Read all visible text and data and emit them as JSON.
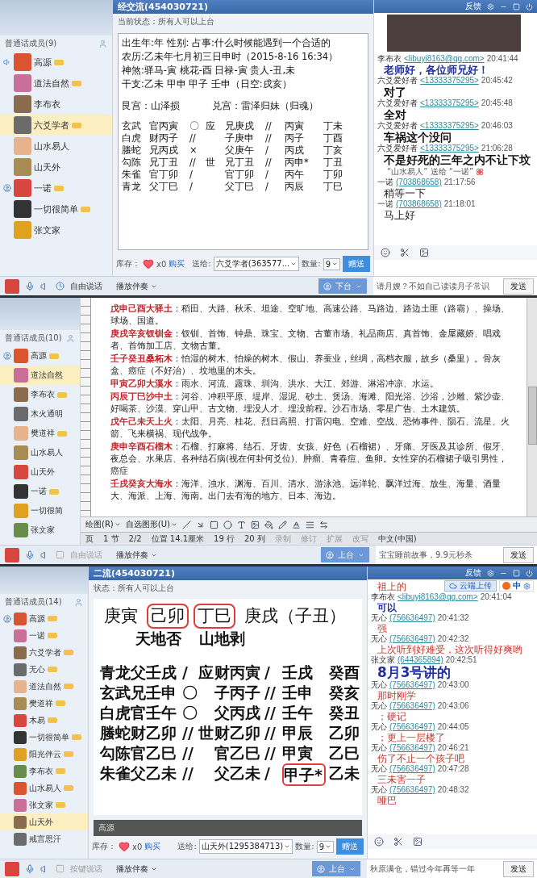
{
  "panels": [
    {
      "kind": "chart-room",
      "title": "经交流(454030721)",
      "status": "当前状态：所有人可以上台",
      "window_label": "反馈",
      "members_header": "普通话成员(9)",
      "members": [
        {
          "name": "高源",
          "vip": true,
          "selected": false,
          "kind": "speaking"
        },
        {
          "name": "道法自然",
          "vip": true,
          "selected": false,
          "kind": "member"
        },
        {
          "name": "李布衣",
          "vip": false,
          "selected": false,
          "kind": "member"
        },
        {
          "name": "六爻学者",
          "vip": true,
          "selected": true,
          "kind": "member"
        },
        {
          "name": "山水易人",
          "vip": false,
          "selected": false,
          "kind": "member"
        },
        {
          "name": "山天外",
          "vip": false,
          "selected": false,
          "kind": "member"
        },
        {
          "name": "一诺",
          "vip": true,
          "selected": false,
          "kind": "host"
        },
        {
          "name": "一切很简单",
          "vip": true,
          "selected": false,
          "kind": "member"
        },
        {
          "name": "张文家",
          "vip": false,
          "selected": false,
          "kind": "member"
        }
      ],
      "chart": {
        "lines": [
          "出生年:年  性别:  占事:什么时候能遇到一个合适的",
          "农历:乙未年七月初三日申时（2015-8-16 16:34）",
          "神煞:驿马-寅 桃花-酉 日禄-寅 贵人-丑,未",
          "干支:乙未  甲申  甲子  壬申（日空:戌亥）"
        ],
        "palaces": [
          "艮宫：山泽损",
          "兑宫：雷泽归妹（归魂）"
        ],
        "rows": [
          {
            "god": "玄武",
            "line_a": "官丙寅",
            "mark_a": "〇",
            "role": "应",
            "line_b": "兄庚戌",
            "mark_b": "//",
            "stem_a": "丙寅",
            "stem_b": "丁未"
          },
          {
            "god": "白虎",
            "line_a": "财丙子",
            "mark_a": "//",
            "line_b": "子庚申",
            "mark_b": "//",
            "stem_a": "丙子",
            "stem_b": "丁酉"
          },
          {
            "god": "螣蛇",
            "line_a": "兄丙戌",
            "mark_a": "×",
            "line_b": "父庚午",
            "mark_b": "/",
            "stem_a": "丙戌",
            "stem_b": "丁亥"
          },
          {
            "god": "勾陈",
            "line_a": "兄丁丑",
            "mark_a": "//",
            "role": "世",
            "line_b": "兄丁丑",
            "mark_b": "//",
            "stem_a": "丙申*",
            "stem_b": "丁丑"
          },
          {
            "god": "朱雀",
            "line_a": "官丁卯",
            "mark_a": "/",
            "line_b": "官丁卯",
            "mark_b": "/",
            "stem_a": "丙午",
            "stem_b": "丁卯"
          },
          {
            "god": "青龙",
            "line_a": "父丁巳",
            "mark_a": "/",
            "line_b": "父丁巳",
            "mark_b": "/",
            "stem_a": "丙辰",
            "stem_b": "丁巳"
          }
        ]
      },
      "gift": {
        "stock_label": "库存：",
        "count": "x0",
        "buy": "购买",
        "to_label": "送给:",
        "recipient": "六爻学者(363577...",
        "qty_label": "数量:",
        "qty": "9",
        "button": "赠送"
      },
      "video": true,
      "messages": [
        {
          "sender": "李布衣",
          "contact": "<libuyi8163@qq.com>",
          "time": "20:41:44",
          "text": "老师好，各位师兄好！",
          "kind": "bold-blue"
        },
        {
          "sender": "六爻爱好者",
          "contact": "<13333375295>",
          "time": "20:45:42",
          "text": "对了",
          "kind": "bold-black"
        },
        {
          "sender": "六爻爱好者",
          "contact": "<13333375295>",
          "time": "20:45:48",
          "text": "全对",
          "kind": "bold-black"
        },
        {
          "sender": "六爻爱好者",
          "contact": "<13333375295>",
          "time": "20:46:03",
          "text": "车祸这个没问",
          "kind": "bold-black"
        },
        {
          "sender": "六爻爱好者",
          "contact": "<13333375295>",
          "time": "21:06:28",
          "text": "不是好死的三年之内不让下坟",
          "kind": "bold-black"
        },
        {
          "text": "“山水易人” 送给 “一诺”",
          "kind": "gift-notice"
        },
        {
          "sender": "一诺",
          "contact": "(703868658)",
          "time": "21:17:56",
          "text": "稍等一下",
          "kind": "plain"
        },
        {
          "sender": "一诺",
          "contact": "(703868658)",
          "time": "21:18:01",
          "text": "马上好",
          "kind": "plain"
        }
      ],
      "talk": {
        "label": "自由说话",
        "disabled": false
      },
      "accompaniment": "播放伴奏",
      "stage_button": "下台",
      "hint": "请月嫂？不如自己读读月子常识",
      "send": "发送"
    },
    {
      "kind": "document-share",
      "members_header": "普通话成员(10)",
      "members": [
        {
          "name": "高源",
          "vip": true,
          "selected": false,
          "kind": "host"
        },
        {
          "name": "道法自然",
          "vip": false,
          "selected": true,
          "kind": "member"
        },
        {
          "name": "李布衣",
          "vip": true,
          "selected": false,
          "kind": "member"
        },
        {
          "name": "木火通明",
          "vip": false,
          "selected": false,
          "kind": "member"
        },
        {
          "name": "樊道祥",
          "vip": true,
          "selected": false,
          "kind": "member"
        },
        {
          "name": "山水易人",
          "vip": false,
          "selected": false,
          "kind": "member"
        },
        {
          "name": "山天外",
          "vip": false,
          "selected": false,
          "kind": "member"
        },
        {
          "name": "一诺",
          "vip": true,
          "selected": false,
          "kind": "member"
        },
        {
          "name": "一切很简",
          "vip": false,
          "selected": false,
          "kind": "member"
        },
        {
          "name": "张文家",
          "vip": false,
          "selected": false,
          "kind": "member"
        }
      ],
      "document": {
        "paragraphs": [
          {
            "term": "戊申己酉大驿土",
            "text": "：稻田、大路、秋禾、坦途、空旷地、高速公路、马路边、路边土匪（路霸）、操场、球场、国道。"
          },
          {
            "term": "庚戌辛亥钗钏金",
            "text": "：钗钏、首饰、钟鼎、珠宝、文物、古董市场、礼品商店、真首饰、金屋藏娇、唱戏者、首饰加工店、文物古董。"
          },
          {
            "term": "壬子癸丑桑柘木",
            "text": "：怕湿的树木、怕燥的树木、假山、养蚕业，丝绸，高档衣服，故乡（桑里）。骨灰盒、癌症（不好治）、坟地里的木头。"
          },
          {
            "term": "甲寅乙卯大溪水",
            "text": "：雨水、河流、露珠、圳沟、洪水、大江、郊游、淋浴冲凉、水运。"
          },
          {
            "term": "丙辰丁巳沙中土",
            "text": "：河谷、冲积平原、堤岸、湿泥、砂土、煲汤、海滩、阳光浴、沙浴，沙雕、紫沙壶、好喝茶、沙漠、穿山甲、古文物、埋没人才、埋没前程。沙石市场、零星广告、土木建筑。"
          },
          {
            "term": "戊午己未天上火",
            "text": "：太阳、月亮、桂花、烈日高照、打雷闪电、空难、空战、恐怖事件、陨石、流星、火箭、飞来横祸、现代战争。"
          },
          {
            "term": "庚申辛酉石榴木",
            "text": "：石榴、打麻将、结石、牙齿、女孩、好色（石榴裙）、牙痛、牙医及其诊所、假牙、夜总会、水果店、各种结石病(视在何卦何爻位)、肿瘤、青春痘、鱼卵。女性穿的石榴裙子吸引男性，癌症"
          },
          {
            "term": "壬戌癸亥大海水",
            "text": "：海洋、浊水、渊海、百川、清水、游泳池、远洋轮、飘洋过海、放生、海量、酒量大、海派、上海、海南。出门去有海的地方、日本、海边。"
          }
        ],
        "draw_menu": "绘图(R)",
        "shapes_menu": "自选图形(U)",
        "status_items": [
          {
            "text": "页",
            "disabled": false
          },
          {
            "text": "1 节",
            "disabled": false
          },
          {
            "text": "2/2",
            "disabled": false
          },
          {
            "text": "位置 14.1厘米",
            "disabled": false
          },
          {
            "text": "19 行",
            "disabled": false
          },
          {
            "text": "20 列",
            "disabled": false
          },
          {
            "text": "录制",
            "disabled": true
          },
          {
            "text": "修订",
            "disabled": true
          },
          {
            "text": "扩展",
            "disabled": true
          },
          {
            "text": "改写",
            "disabled": true
          },
          {
            "text": "中文(中国)",
            "disabled": false
          }
        ]
      },
      "talk": {
        "label": "自由说话",
        "disabled": true
      },
      "accompaniment": "播放伴奏",
      "stage_button": "上台",
      "hint": "宝宝睡前故事，9.9元秒杀",
      "send": "发送"
    },
    {
      "kind": "whiteboard-room",
      "title": "二流(454030721)",
      "status": "状态：所有人可以上台",
      "window_label": "反馈",
      "members_header": "普通话成员(14)",
      "members": [
        {
          "name": "高源",
          "vip": true,
          "selected": false,
          "kind": "host"
        },
        {
          "name": "一诺",
          "vip": true,
          "selected": false,
          "kind": "member"
        },
        {
          "name": "六爻学者",
          "vip": true,
          "selected": false,
          "kind": "member"
        },
        {
          "name": "无心",
          "vip": true,
          "selected": false,
          "kind": "member"
        },
        {
          "name": "道法自然",
          "vip": true,
          "selected": false,
          "kind": "member"
        },
        {
          "name": "樊道祥",
          "vip": true,
          "selected": false,
          "kind": "member"
        },
        {
          "name": "木易",
          "vip": true,
          "selected": false,
          "kind": "member"
        },
        {
          "name": "一切很简单",
          "vip": true,
          "selected": false,
          "kind": "member"
        },
        {
          "name": "阳光伴云",
          "vip": true,
          "selected": false,
          "kind": "member"
        },
        {
          "name": "李布衣",
          "vip": true,
          "selected": false,
          "kind": "member"
        },
        {
          "name": "山水易人",
          "vip": true,
          "selected": false,
          "kind": "member"
        },
        {
          "name": "张文家",
          "vip": true,
          "selected": false,
          "kind": "member"
        },
        {
          "name": "山天外",
          "vip": false,
          "selected": true,
          "kind": "member"
        },
        {
          "name": "戒言思汗",
          "vip": false,
          "selected": false,
          "kind": "member"
        }
      ],
      "board": {
        "pillars": [
          {
            "text": "庚寅",
            "circled": false
          },
          {
            "text": "己卯",
            "circled": true
          },
          {
            "text": "丁巳",
            "circled": true
          },
          {
            "text": "庚戌（子丑）",
            "circled": false
          }
        ],
        "hexagrams": [
          "天地否",
          "山地剥"
        ],
        "rows": [
          {
            "line_a": "青龙父壬戌",
            "mark_a": "/",
            "role": "应",
            "line_b": "财丙寅",
            "mark_b": "/",
            "stem_a": "壬戌",
            "stem_b": "癸酉",
            "circled": false
          },
          {
            "line_a": "玄武兄壬申",
            "mark_a": "〇",
            "line_b": "子丙子",
            "mark_b": "//",
            "stem_a": "壬申",
            "stem_b": "癸亥",
            "circled": false
          },
          {
            "line_a": "白虎官壬午",
            "mark_a": "〇",
            "line_b": "父丙戌",
            "mark_b": "//",
            "stem_a": "壬午",
            "stem_b": "癸丑",
            "circled": false
          },
          {
            "line_a": "螣蛇财乙卯",
            "mark_a": "//",
            "role": "世",
            "line_b": "财乙卯",
            "mark_b": "//",
            "stem_a": "甲辰",
            "stem_b": "乙卯",
            "circled": false
          },
          {
            "line_a": "勾陈官乙巳",
            "mark_a": "//",
            "line_b": "官乙巳",
            "mark_b": "//",
            "stem_a": "甲寅",
            "stem_b": "乙巳",
            "circled": false
          },
          {
            "line_a": "朱雀父乙未",
            "mark_a": "//",
            "line_b": "父乙未",
            "mark_b": "/",
            "stem_a": "甲子*",
            "stem_b": "乙未",
            "circled": true
          }
        ],
        "presenter": "高源"
      },
      "gift": {
        "stock_label": "库存：",
        "count": "x0",
        "buy": "购买",
        "to_label": "送给:",
        "recipient": "山天外(1295384713)",
        "qty_label": "数量:",
        "qty": "9",
        "button": "赠送"
      },
      "upload_button": "云端上传",
      "ime_label": "中",
      "messages": [
        {
          "text": "祖上的",
          "kind": "red"
        },
        {
          "sender": "李布衣",
          "contact": "<libuyi8163@qq.com>",
          "time": "20:41:04",
          "text": "可以",
          "kind": "bold-blue"
        },
        {
          "sender": "无心",
          "contact": "(756636497)",
          "time": "20:41:32",
          "text": "强",
          "kind": "red"
        },
        {
          "sender": "无心",
          "contact": "(756636497)",
          "time": "20:42:32",
          "text": "上次听到好难受，这次听得好爽哟",
          "kind": "red"
        },
        {
          "sender": "张文家",
          "contact": "(644365894)",
          "time": "20:42:51",
          "text": "8月3号讲的",
          "kind": "large-blue"
        },
        {
          "sender": "无心",
          "contact": "(756636497)",
          "time": "20:43:00",
          "text": "那时刚学",
          "kind": "red"
        },
        {
          "sender": "无心",
          "contact": "(756636497)",
          "time": "20:43:06",
          "text": "；硬记",
          "kind": "red"
        },
        {
          "sender": "无心",
          "contact": "(756636497)",
          "time": "20:44:05",
          "text": "；更上一层楼了",
          "kind": "red"
        },
        {
          "sender": "无心",
          "contact": "(756636497)",
          "time": "20:46:21",
          "text": "伤了不止一个孩子吧",
          "kind": "red"
        },
        {
          "sender": "无心",
          "contact": "(756636497)",
          "time": "20:47:28",
          "text": "三未害一子",
          "kind": "red"
        },
        {
          "sender": "无心",
          "contact": "(756636497)",
          "time": "20:48:32",
          "text": "哑巴",
          "kind": "red"
        }
      ],
      "talk": {
        "label": "按键说话",
        "disabled": true
      },
      "accompaniment": "播放伴奏",
      "stage_button": "上台",
      "hint": "秋原满仓，错过今年再等一年",
      "send": "发送"
    }
  ]
}
